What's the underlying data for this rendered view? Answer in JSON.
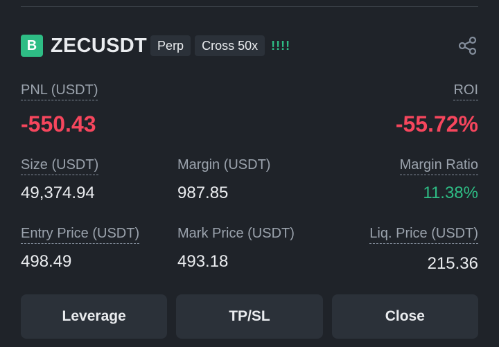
{
  "position": {
    "side_badge": "B",
    "symbol": "ZECUSDT",
    "contract_type": "Perp",
    "margin_mode": "Cross 50x",
    "signal_bars": "!!!!",
    "share_icon": "share-icon"
  },
  "pnl": {
    "label": "PNL (USDT)",
    "value": "-550.43"
  },
  "roi": {
    "label": "ROI",
    "value": "-55.72%"
  },
  "size": {
    "label": "Size (USDT)",
    "value": "49,374.94"
  },
  "margin": {
    "label": "Margin (USDT)",
    "value": "987.85"
  },
  "margin_ratio": {
    "label": "Margin Ratio",
    "value": "11.38%"
  },
  "entry_price": {
    "label": "Entry Price (USDT)",
    "value": "498.49"
  },
  "mark_price": {
    "label": "Mark Price (USDT)",
    "value": "493.18"
  },
  "liq_price": {
    "label": "Liq. Price (USDT)",
    "value": "215.36"
  },
  "actions": {
    "leverage": "Leverage",
    "tpsl": "TP/SL",
    "close": "Close"
  },
  "colors": {
    "background": "#1f2329",
    "buy_green": "#2ebd85",
    "loss_red": "#f6465d",
    "button_bg": "#2b3139"
  }
}
